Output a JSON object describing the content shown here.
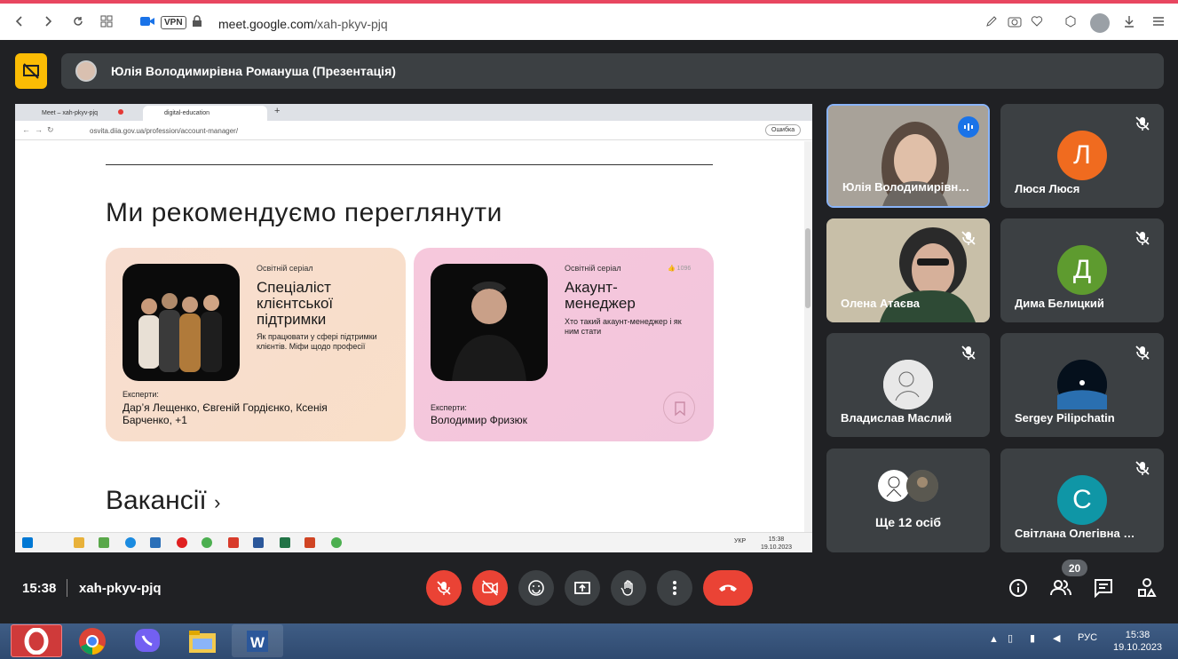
{
  "browser": {
    "url_host": "meet.google.com",
    "url_path": "/xah-pkyv-pjq",
    "vpn_label": "VPN"
  },
  "meet": {
    "presenter": "Юлія Володимирівна Романуша (Презентація)",
    "time": "15:38",
    "code": "xah-pkyv-pjq",
    "people_count": "20"
  },
  "shared": {
    "tab1": "Meet – xah-pkyv-pjq",
    "tab2": "digital-education",
    "url": "osvita.diia.gov.ua/profession/account-manager/",
    "err": "Ошибка",
    "heading": "Ми рекомендуємо переглянути",
    "card1": {
      "sub": "Освітній серіал",
      "title": "Спеціаліст клієнтської підтримки",
      "desc": "Як працювати у сфері підтримки клієнтів. Міфи щодо професії",
      "experts_label": "Експерти:",
      "experts": "Дар’я Лещенко, Євгеній Гордієнко, Ксенія Барченко, +1"
    },
    "card2": {
      "sub": "Освітній серіал",
      "title": "Акаунт-менеджер",
      "desc": "Хто такий акаунт-менеджер і як ним стати",
      "experts_label": "Експерти:",
      "experts": "Володимир Фризюк",
      "likes": "1096"
    },
    "heading2": "Вакансії",
    "clock_time": "15:38",
    "clock_date": "19.10.2023",
    "lang": "УКР"
  },
  "participants": [
    {
      "name": "Юлія Володимирівн…"
    },
    {
      "name": "Люся Люся",
      "initial": "Л",
      "color": "#f06b1f"
    },
    {
      "name": "Олена Атаєва"
    },
    {
      "name": "Дима Белицкий",
      "initial": "Д",
      "color": "#5e9b2f"
    },
    {
      "name": "Владислав Маслий"
    },
    {
      "name": "Sergey Pilipchatin"
    },
    {
      "name": "Ще 12 осіб"
    },
    {
      "name": "Світлана Олегівна …",
      "initial": "С",
      "color": "#0f96a6"
    }
  ],
  "taskbar": {
    "lang": "РУС",
    "time": "15:38",
    "date": "19.10.2023"
  }
}
